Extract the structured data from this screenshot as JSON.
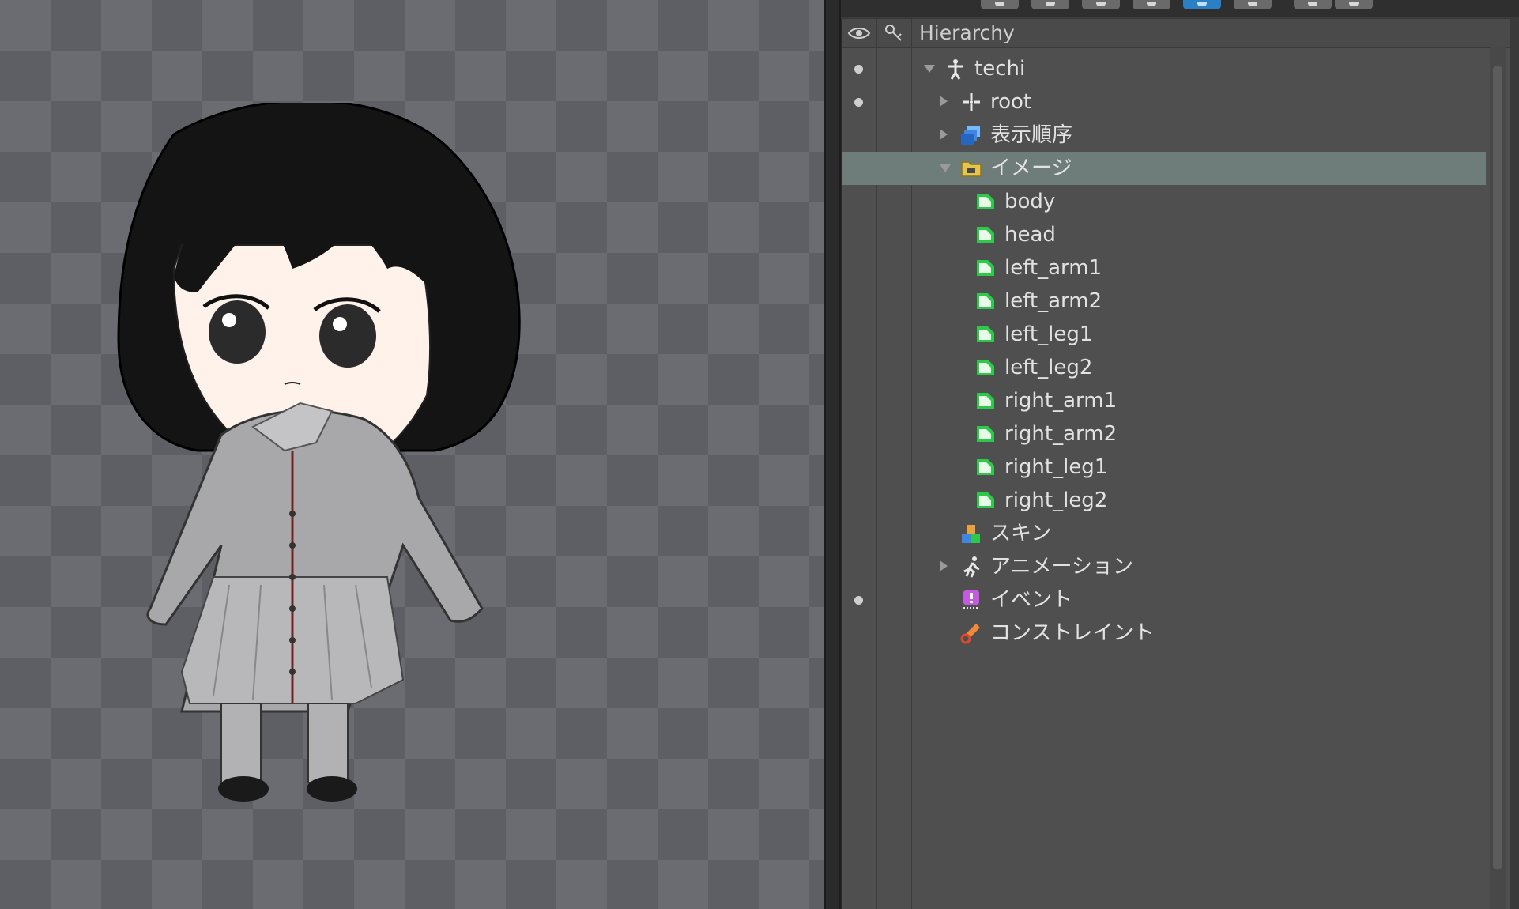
{
  "hierarchy": {
    "title": "Hierarchy",
    "rows": [
      {
        "label": "techi",
        "icon": "skeleton-icon",
        "depth": 0,
        "expander": "down",
        "visible_dot": true
      },
      {
        "label": "root",
        "icon": "bone-icon",
        "depth": 1,
        "expander": "right",
        "visible_dot": true
      },
      {
        "label": "表示順序",
        "icon": "draw-order-icon",
        "depth": 1,
        "expander": "right",
        "visible_dot": false
      },
      {
        "label": "イメージ",
        "icon": "images-folder-icon",
        "depth": 1,
        "expander": "down",
        "visible_dot": false,
        "selected": true
      },
      {
        "label": "body",
        "icon": "image-icon",
        "depth": 2,
        "expander": "none",
        "visible_dot": false
      },
      {
        "label": "head",
        "icon": "image-icon",
        "depth": 2,
        "expander": "none",
        "visible_dot": false
      },
      {
        "label": "left_arm1",
        "icon": "image-icon",
        "depth": 2,
        "expander": "none",
        "visible_dot": false
      },
      {
        "label": "left_arm2",
        "icon": "image-icon",
        "depth": 2,
        "expander": "none",
        "visible_dot": false
      },
      {
        "label": "left_leg1",
        "icon": "image-icon",
        "depth": 2,
        "expander": "none",
        "visible_dot": false
      },
      {
        "label": "left_leg2",
        "icon": "image-icon",
        "depth": 2,
        "expander": "none",
        "visible_dot": false
      },
      {
        "label": "right_arm1",
        "icon": "image-icon",
        "depth": 2,
        "expander": "none",
        "visible_dot": false
      },
      {
        "label": "right_arm2",
        "icon": "image-icon",
        "depth": 2,
        "expander": "none",
        "visible_dot": false
      },
      {
        "label": "right_leg1",
        "icon": "image-icon",
        "depth": 2,
        "expander": "none",
        "visible_dot": false
      },
      {
        "label": "right_leg2",
        "icon": "image-icon",
        "depth": 2,
        "expander": "none",
        "visible_dot": false
      },
      {
        "label": "スキン",
        "icon": "skins-icon",
        "depth": 1,
        "expander": "none",
        "visible_dot": false
      },
      {
        "label": "アニメーション",
        "icon": "animation-icon",
        "depth": 1,
        "expander": "right",
        "visible_dot": false
      },
      {
        "label": "イベント",
        "icon": "event-icon",
        "depth": 1,
        "expander": "none",
        "visible_dot": true
      },
      {
        "label": "コンストレイント",
        "icon": "constraint-icon",
        "depth": 1,
        "expander": "none",
        "visible_dot": false
      }
    ]
  },
  "header_icons": {
    "visibility": "eye-icon",
    "keys": "key-icon"
  },
  "colors": {
    "panel_bg": "#4f4f4f",
    "selected_row": "#6e7c7a",
    "image_icon_green": "#2ec84a",
    "active_tool": "#2a7fc5",
    "checker_light": "#6b6b72",
    "checker_dark": "#5e5e65"
  }
}
